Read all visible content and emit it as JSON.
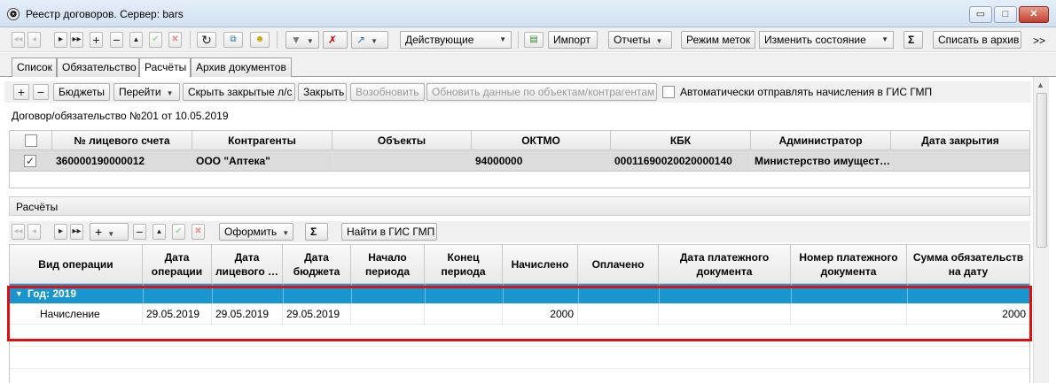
{
  "window": {
    "title": "Реестр договоров. Сервер: bars",
    "app_icon_glyph": "❂",
    "minimize": "▭",
    "maximize": "□",
    "close": "✕"
  },
  "toolbar": {
    "filter_value": "Действующие",
    "import_label": "Импорт",
    "reports_label": "Отчеты",
    "marks_mode_label": "Режим меток",
    "change_state_label": "Изменить состояние",
    "sum_glyph": "Σ",
    "archive_label": "Списать в архив",
    "more_glyph": ">>",
    "nav": {
      "first": "◂◂",
      "prev": "◂",
      "next": "▸",
      "last": "▸▸",
      "add": "+",
      "remove": "−",
      "up": "▲",
      "ok": "✔",
      "cancel": "✖"
    },
    "icons": {
      "refresh": "↻",
      "copy": "⧉",
      "sign": "☻",
      "funnel": "▼",
      "funnel_clear": "✗",
      "arrow": "↗",
      "excel": "▤"
    }
  },
  "tabs": [
    "Список",
    "Обязательство",
    "Расчёты",
    "Архив документов"
  ],
  "active_tab": 2,
  "calc_toolbar": {
    "plus": "+",
    "minus": "−",
    "budgets": "Бюджеты",
    "goto": "Перейти",
    "hide_closed": "Скрыть закрытые л/с",
    "close": "Закрыть",
    "resume": "Возобновить",
    "update_data": "Обновить данные по объектам/контрагентам",
    "auto_send": "Автоматически отправлять начисления в ГИС ГМП"
  },
  "contract_label": "Договор/обязательство №201 от 10.05.2019",
  "accounts_grid": {
    "columns": [
      "№ лицевого счета",
      "Контрагенты",
      "Объекты",
      "ОКТМО",
      "КБК",
      "Администратор",
      "Дата закрытия"
    ],
    "rows": [
      {
        "checked": "✓",
        "account": "360000190000012",
        "counterparty": "ООО \"Аптека\"",
        "objects": "",
        "oktmo": "94000000",
        "kbk": "00011690020020000140",
        "admin": "Министерство имущест…",
        "close_date": ""
      }
    ]
  },
  "section_title": "Расчёты",
  "calc_bar": {
    "first": "◂◂",
    "prev": "◂",
    "next": "▸",
    "last": "▸▸",
    "add": "+",
    "remove": "−",
    "up": "▲",
    "ok": "✔",
    "cancel": "✖",
    "format_label": "Оформить",
    "sum_glyph": "Σ",
    "find_gis": "Найти в ГИС ГМП"
  },
  "calc_grid": {
    "columns": [
      "Вид операции",
      "Дата операции",
      "Дата лицевого …",
      "Дата бюджета",
      "Начало периода",
      "Конец периода",
      "Начислено",
      "Оплачено",
      "Дата платежного документа",
      "Номер платежного документа",
      "Сумма обязательств на дату"
    ],
    "group": {
      "arrow": "▼",
      "label": "Год: 2019"
    },
    "rows": [
      {
        "op": "Начисление",
        "d_op": "29.05.2019",
        "d_acc": "29.05.2019",
        "d_bud": "29.05.2019",
        "start": "",
        "end": "",
        "accrued": "2000",
        "paid": "",
        "pay_date": "",
        "pay_num": "",
        "sum": "2000"
      }
    ]
  },
  "scroll_up": "▲",
  "colors": {
    "highlight": "#e01010",
    "group_row": "#1a96cf",
    "selected_row": "#dcdcdc"
  }
}
